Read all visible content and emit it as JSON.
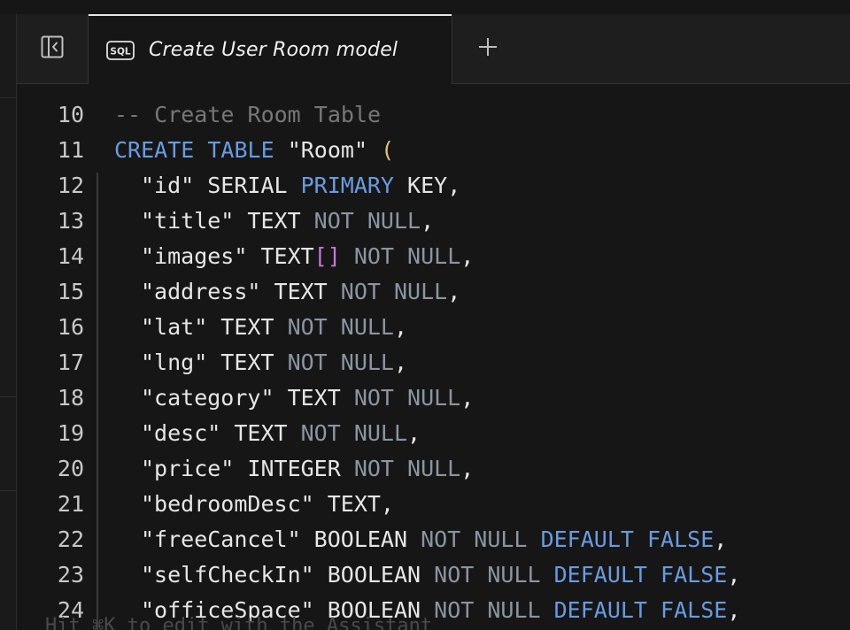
{
  "tab": {
    "title": "Create User Room model",
    "icon": "sql-file-icon"
  },
  "toolbar": {
    "sidebar_toggle_icon": "sidebar-collapse-icon",
    "add_tab_icon": "plus-icon"
  },
  "colors": {
    "keyword": "#6a9be0",
    "dim_keyword": "#8b95a3",
    "comment": "#777777",
    "paren": "#e5c07b",
    "bracket": "#c678dd",
    "text": "#e6e6e6"
  },
  "editor": {
    "lines": [
      {
        "n": "10",
        "parts": [
          [
            "cm",
            "-- Create Room Table"
          ]
        ]
      },
      {
        "n": "11",
        "parts": [
          [
            "kw",
            "CREATE"
          ],
          [
            "",
            " "
          ],
          [
            "kw",
            "TABLE"
          ],
          [
            "",
            " \"Room\" "
          ],
          [
            "paren",
            "("
          ]
        ]
      },
      {
        "n": "12",
        "indent": true,
        "parts": [
          [
            "",
            "\"id\" SERIAL "
          ],
          [
            "kw",
            "PRIMARY"
          ],
          [
            "",
            " KEY,"
          ]
        ]
      },
      {
        "n": "13",
        "indent": true,
        "parts": [
          [
            "",
            "\"title\" TEXT "
          ],
          [
            "dim",
            "NOT NULL"
          ],
          [
            "",
            ","
          ]
        ]
      },
      {
        "n": "14",
        "indent": true,
        "parts": [
          [
            "",
            "\"images\" TEXT"
          ],
          [
            "br",
            "[]"
          ],
          [
            "",
            " "
          ],
          [
            "dim",
            "NOT NULL"
          ],
          [
            "",
            ","
          ]
        ]
      },
      {
        "n": "15",
        "indent": true,
        "parts": [
          [
            "",
            "\"address\" TEXT "
          ],
          [
            "dim",
            "NOT NULL"
          ],
          [
            "",
            ","
          ]
        ]
      },
      {
        "n": "16",
        "indent": true,
        "parts": [
          [
            "",
            "\"lat\" TEXT "
          ],
          [
            "dim",
            "NOT NULL"
          ],
          [
            "",
            ","
          ]
        ]
      },
      {
        "n": "17",
        "indent": true,
        "parts": [
          [
            "",
            "\"lng\" TEXT "
          ],
          [
            "dim",
            "NOT NULL"
          ],
          [
            "",
            ","
          ]
        ]
      },
      {
        "n": "18",
        "indent": true,
        "parts": [
          [
            "",
            "\"category\" TEXT "
          ],
          [
            "dim",
            "NOT NULL"
          ],
          [
            "",
            ","
          ]
        ]
      },
      {
        "n": "19",
        "indent": true,
        "parts": [
          [
            "",
            "\"desc\" TEXT "
          ],
          [
            "dim",
            "NOT NULL"
          ],
          [
            "",
            ","
          ]
        ]
      },
      {
        "n": "20",
        "indent": true,
        "parts": [
          [
            "",
            "\"price\" INTEGER "
          ],
          [
            "dim",
            "NOT NULL"
          ],
          [
            "",
            ","
          ]
        ]
      },
      {
        "n": "21",
        "indent": true,
        "parts": [
          [
            "",
            "\"bedroomDesc\" TEXT,"
          ]
        ]
      },
      {
        "n": "22",
        "indent": true,
        "parts": [
          [
            "",
            "\"freeCancel\" BOOLEAN "
          ],
          [
            "dim",
            "NOT NULL"
          ],
          [
            "",
            " "
          ],
          [
            "kw",
            "DEFAULT"
          ],
          [
            "",
            " "
          ],
          [
            "kw",
            "FALSE"
          ],
          [
            "",
            ","
          ]
        ]
      },
      {
        "n": "23",
        "indent": true,
        "parts": [
          [
            "",
            "\"selfCheckIn\" BOOLEAN "
          ],
          [
            "dim",
            "NOT NULL"
          ],
          [
            "",
            " "
          ],
          [
            "kw",
            "DEFAULT"
          ],
          [
            "",
            " "
          ],
          [
            "kw",
            "FALSE"
          ],
          [
            "",
            ","
          ]
        ]
      },
      {
        "n": "24",
        "indent": true,
        "parts": [
          [
            "",
            "\"officeSpace\" BOOLEAN "
          ],
          [
            "dim",
            "NOT NULL"
          ],
          [
            "",
            " "
          ],
          [
            "kw",
            "DEFAULT"
          ],
          [
            "",
            " "
          ],
          [
            "kw",
            "FALSE"
          ],
          [
            "",
            ","
          ]
        ]
      }
    ],
    "hint": "Hit ⌘K to edit with the Assistant"
  }
}
